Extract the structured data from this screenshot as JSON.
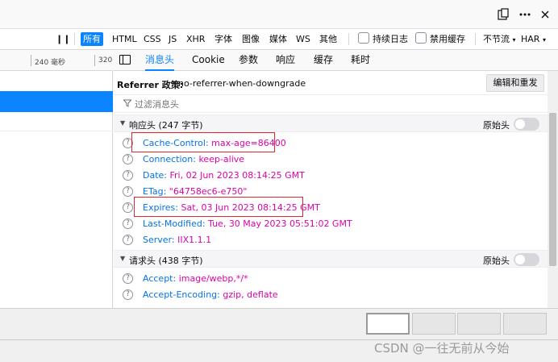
{
  "toolbar": {
    "filters": [
      "所有",
      "HTML",
      "CSS",
      "JS",
      "XHR",
      "字体",
      "图像",
      "媒体",
      "WS",
      "其他"
    ],
    "persist_logs": "持续日志",
    "disable_cache": "禁用缓存",
    "throttle": "不节流",
    "har": "HAR"
  },
  "timeline": {
    "ticks": [
      "240 毫秒",
      "320"
    ]
  },
  "tabs": [
    "消息头",
    "Cookie",
    "参数",
    "响应",
    "缓存",
    "耗时"
  ],
  "referrer": {
    "label": "Referrer 政策:",
    "value": "no-referrer-when-downgrade",
    "button": "编辑和重发"
  },
  "filter": {
    "placeholder": "过滤消息头"
  },
  "response_headers": {
    "title": "响应头 (247 字节)",
    "raw_label": "原始头",
    "items": [
      {
        "name": "Cache-Control:",
        "value": "max-age=86400"
      },
      {
        "name": "Connection:",
        "value": "keep-alive"
      },
      {
        "name": "Date:",
        "value": "Fri, 02 Jun 2023 08:14:25 GMT"
      },
      {
        "name": "ETag:",
        "value": "\"64758ec6-e750\""
      },
      {
        "name": "Expires:",
        "value": "Sat, 03 Jun 2023 08:14:25 GMT"
      },
      {
        "name": "Last-Modified:",
        "value": "Tue, 30 May 2023 05:51:02 GMT"
      },
      {
        "name": "Server:",
        "value": "IIX1.1.1"
      }
    ]
  },
  "request_headers": {
    "title": "请求头 (438 字节)",
    "raw_label": "原始头",
    "items": [
      {
        "name": "Accept:",
        "value": "image/webp,*/*"
      },
      {
        "name": "Accept-Encoding:",
        "value": "gzip, deflate"
      }
    ]
  },
  "watermark": "CSDN @一往无前从今始",
  "colors": {
    "accent": "#0a84ff",
    "header_name": "#0074e8",
    "header_value": "#dd00a9",
    "highlight": "#e2262c"
  }
}
